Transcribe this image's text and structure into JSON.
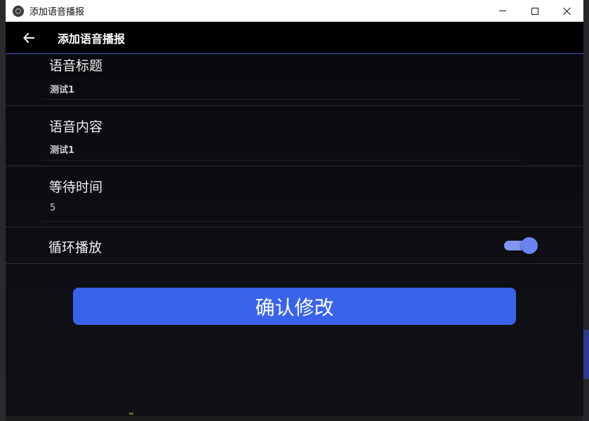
{
  "window": {
    "title": "添加语音播报"
  },
  "header": {
    "title": "添加语音播报"
  },
  "form": {
    "fields": [
      {
        "label": "语音标题",
        "value": "测试1"
      },
      {
        "label": "语音内容",
        "value": "测试1"
      },
      {
        "label": "等待时间",
        "value": "5"
      }
    ],
    "loop": {
      "label": "循环播放",
      "enabled": true
    }
  },
  "actions": {
    "confirm_label": "确认修改"
  },
  "colors": {
    "accent": "#3a63ec",
    "header_divider": "#4a57c9",
    "toggle_on": "#6a83f0",
    "background": "#0b0b0f"
  }
}
